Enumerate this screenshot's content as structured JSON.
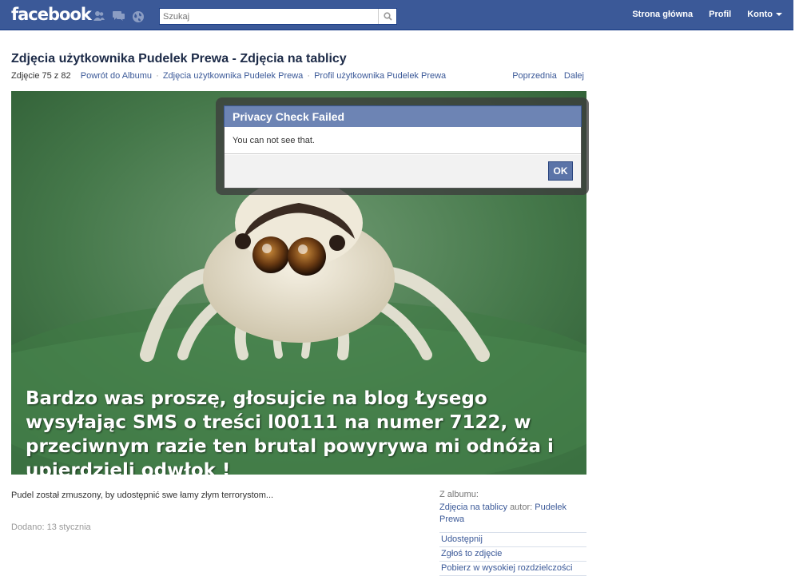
{
  "topbar": {
    "logo": "facebook",
    "search_placeholder": "Szukaj",
    "nav": [
      "Strona główna",
      "Profil",
      "Konto"
    ]
  },
  "page": {
    "title": "Zdjęcia użytkownika Pudelek Prewa - Zdjęcia na tablicy",
    "counter": "Zdjęcie 75 z 82",
    "breadcrumbs": [
      "Powrót do Albumu",
      "Zdjęcia użytkownika Pudelek Prewa",
      "Profil użytkownika Pudelek Prewa"
    ],
    "prev": "Poprzednia",
    "next": "Dalej"
  },
  "photo": {
    "caption": "Bardzo was proszę, głosujcie na blog Łysego wysyłając SMS o treści l00111 na numer 7122, w przeciwnym razie ten brutal powyrywa mi odnóża i upierdzieli odwłok !"
  },
  "dialog": {
    "title": "Privacy Check Failed",
    "message": "You can not see that.",
    "ok": "OK"
  },
  "details": {
    "description": "Pudel został zmuszony, by udostępnić swe łamy złym terrorystom...",
    "added": "Dodano: 13 stycznia",
    "from_album_label": "Z albumu:",
    "album_link": "Zdjęcia na tablicy",
    "author_label": "autor:",
    "author_link": "Pudelek Prewa",
    "actions": [
      "Udostępnij",
      "Zgłoś to zdjęcie",
      "Pobierz w wysokiej rozdzielczości"
    ]
  },
  "colors": {
    "brand": "#3b5998",
    "dialog_header": "#6d84b4"
  },
  "icons": [
    "friend-requests-icon",
    "messages-icon",
    "notifications-globe-icon",
    "search-icon",
    "chevron-down-icon"
  ]
}
